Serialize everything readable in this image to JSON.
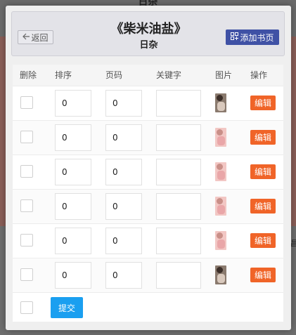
{
  "background": {
    "title": "日杂",
    "edge_char": "昌"
  },
  "header": {
    "back_label": "返回",
    "back_icon": "arrow-left-icon",
    "title": "《柴米油盐》",
    "subtitle": "日杂",
    "add_label": "添加书页",
    "add_icon": "add-page-icon",
    "accent": "#3f51a5"
  },
  "table": {
    "columns": [
      "删除",
      "排序",
      "页码",
      "关键字",
      "图片",
      "操作"
    ],
    "rows": [
      {
        "order": "0",
        "page": "0",
        "keyword": "",
        "thumb_theme": "dark",
        "edit_label": "编辑"
      },
      {
        "order": "0",
        "page": "0",
        "keyword": "",
        "thumb_theme": "pink",
        "edit_label": "编辑"
      },
      {
        "order": "0",
        "page": "0",
        "keyword": "",
        "thumb_theme": "pink",
        "edit_label": "编辑"
      },
      {
        "order": "0",
        "page": "0",
        "keyword": "",
        "thumb_theme": "pink",
        "edit_label": "编辑"
      },
      {
        "order": "0",
        "page": "0",
        "keyword": "",
        "thumb_theme": "pink",
        "edit_label": "编辑"
      },
      {
        "order": "0",
        "page": "0",
        "keyword": "",
        "thumb_theme": "dark",
        "edit_label": "编辑"
      }
    ],
    "edit_color": "#f06428"
  },
  "footer": {
    "submit_label": "提交",
    "submit_color": "#1a9ff0"
  }
}
